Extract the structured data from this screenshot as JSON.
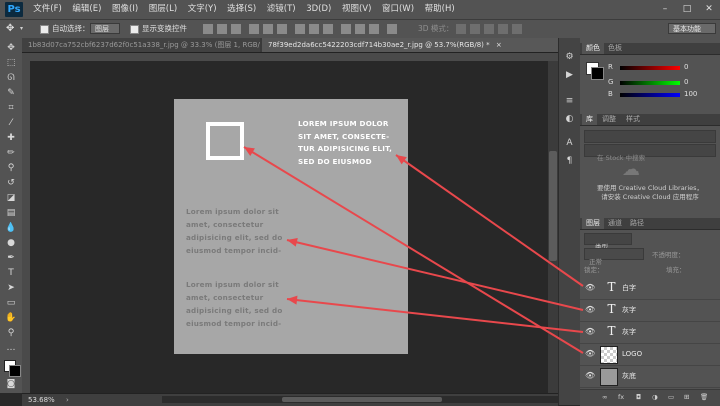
{
  "app": {
    "logo": "Ps"
  },
  "menu": [
    "文件(F)",
    "编辑(E)",
    "图像(I)",
    "图层(L)",
    "文字(Y)",
    "选择(S)",
    "滤镜(T)",
    "3D(D)",
    "视图(V)",
    "窗口(W)",
    "帮助(H)"
  ],
  "window_controls": {
    "minimize": "–",
    "maximize": "□",
    "close": "✕"
  },
  "options_bar": {
    "auto_select_label": "自动选择：",
    "auto_select_value": "图层",
    "show_transform_label": "显示变换控件",
    "mode_3d_label": "3D 模式：",
    "workspace": "基本功能"
  },
  "tabs": [
    {
      "label": "1b83d07ca752cbf6237d62f0c51a338_r.jpg @ 33.3% (图层 1, RGB/8) *",
      "close": "×"
    },
    {
      "label": "78f39ed2da6cc5422203cdf714b30ae2_r.jpg @ 53.7%(RGB/8) *",
      "close": "×"
    }
  ],
  "status": {
    "zoom": "53.68%"
  },
  "document": {
    "heading_lines": [
      "LOREM IPSUM DOLOR",
      "SIT AMET, CONSECTE-",
      "TUR ADIPISICING ELIT,",
      "SED DO EIUSMOD"
    ],
    "para1_lines": [
      "Lorem ipsum dolor sit",
      "amet, consectetur",
      "adipisicing elit, sed do",
      "eiusmod tempor incid-"
    ],
    "para2_lines": [
      "Lorem ipsum dolor sit",
      "amet, consectetur",
      "adipisicing elit, sed do",
      "eiusmod tempor incid-"
    ]
  },
  "color_panel": {
    "tabs": [
      "颜色",
      "色板"
    ],
    "r_label": "R",
    "g_label": "G",
    "b_label": "B",
    "r_value": "0",
    "g_value": "0",
    "b_value": "100"
  },
  "library_panel": {
    "tabs": [
      "库",
      "调整",
      "样式"
    ],
    "search_placeholder": "在 Stock 中搜索",
    "message_line1": "要使用 Creative Cloud Libraries，",
    "message_line2": "请安装 Creative Cloud 应用程序"
  },
  "layers_panel": {
    "tabs": [
      "图层",
      "通道",
      "路径"
    ],
    "kind_label": "类型",
    "blend_mode": "正常",
    "opacity_label": "不透明度：",
    "lock_label": "锁定：",
    "fill_label": "填充：",
    "layers": [
      {
        "name": "白字",
        "kind": "text"
      },
      {
        "name": "灰字",
        "kind": "text"
      },
      {
        "name": "灰字",
        "kind": "text"
      },
      {
        "name": "LOGO",
        "kind": "smart"
      },
      {
        "name": "灰底",
        "kind": "fill"
      }
    ]
  },
  "colors": {
    "annotation_arrow": "#e8484c",
    "document_bg": "#a7a7a7",
    "app_bg": "#282828"
  }
}
